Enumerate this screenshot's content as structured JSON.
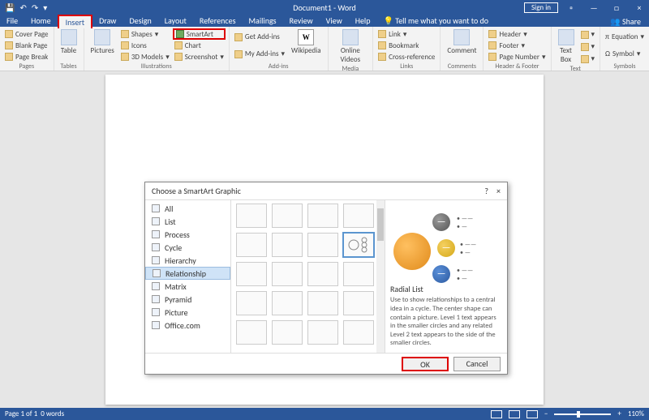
{
  "titlebar": {
    "doc": "Document1 - Word",
    "signin": "Sign in"
  },
  "tabs": [
    "File",
    "Home",
    "Insert",
    "Draw",
    "Design",
    "Layout",
    "References",
    "Mailings",
    "Review",
    "View",
    "Help"
  ],
  "tell_me": "Tell me what you want to do",
  "share": "Share",
  "ribbon": {
    "pages": {
      "label": "Pages",
      "cover": "Cover Page",
      "blank": "Blank Page",
      "break": "Page Break"
    },
    "tables": {
      "label": "Tables",
      "table": "Table"
    },
    "illus": {
      "label": "Illustrations",
      "pictures": "Pictures",
      "shapes": "Shapes",
      "icons": "Icons",
      "models": "3D Models",
      "smartart": "SmartArt",
      "chart": "Chart",
      "screenshot": "Screenshot"
    },
    "addins": {
      "label": "Add-ins",
      "get": "Get Add-ins",
      "my": "My Add-ins",
      "wiki": "Wikipedia"
    },
    "media": {
      "label": "Media",
      "video": "Online Videos"
    },
    "links": {
      "label": "Links",
      "link": "Link",
      "bookmark": "Bookmark",
      "cross": "Cross-reference"
    },
    "comments": {
      "label": "Comments",
      "comment": "Comment"
    },
    "hf": {
      "label": "Header & Footer",
      "header": "Header",
      "footer": "Footer",
      "pnum": "Page Number"
    },
    "text": {
      "label": "Text",
      "textbox": "Text Box"
    },
    "symbols": {
      "label": "Symbols",
      "eq": "Equation",
      "sym": "Symbol"
    }
  },
  "dialog": {
    "title": "Choose a SmartArt Graphic",
    "help_marker": "?",
    "categories": [
      "All",
      "List",
      "Process",
      "Cycle",
      "Hierarchy",
      "Relationship",
      "Matrix",
      "Pyramid",
      "Picture",
      "Office.com"
    ],
    "selected_category": "Relationship",
    "preview": {
      "name": "Radial List",
      "desc": "Use to show relationships to a central idea in a cycle. The center shape can contain a picture. Level 1 text appears in the smaller circles and any related Level 2 text appears to the side of the smaller circles."
    },
    "ok": "OK",
    "cancel": "Cancel"
  },
  "status": {
    "page": "Page 1 of 1",
    "words": "0 words",
    "zoom": "110%"
  }
}
